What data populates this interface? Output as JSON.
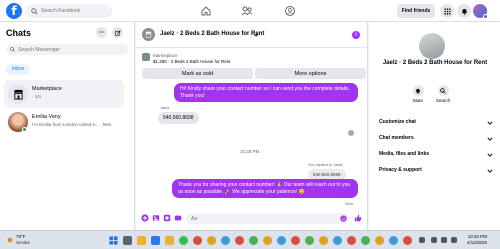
{
  "topbar": {
    "logo": "f",
    "search_placeholder": "Search Facebook",
    "find_friends": "Find friends"
  },
  "chats": {
    "title": "Chats",
    "more": "···",
    "search_placeholder": "Search Messenger",
    "inbox": "Inbox",
    "items": [
      {
        "name": "Marketplace",
        "sub": "· 1m"
      },
      {
        "name": "Emilia Veny",
        "sub": "I'm Emilia from London united k... · 58m"
      }
    ]
  },
  "conversation": {
    "title": "Jaelz · 2 Beds 2 Bath House for Rent",
    "listing_source": "Marketplace",
    "listing_price": "$1,250 · 2 Beds 2 Bath House for Rent",
    "mark_as_sold": "Mark as sold",
    "more_options": "More options",
    "msg1": "Hi! Kindly share your contact number so I can send you the complete details. Thank you!",
    "sender": "Jaelz",
    "msg2": "540.560.8698",
    "time": "10:38 PM",
    "replied": "You replied to Jaelz",
    "quoted": "540.560.8698",
    "msg3": "Thank you for sharing your contact number! 🙏 Our team will reach out to you as soon as possible. 🚀 We appreciate your patience! 😊",
    "sent": "Sent",
    "composer_placeholder": "Aa"
  },
  "details": {
    "title": "Jaelz · 2 Beds 2 Bath House for Rent",
    "mute": "Mute",
    "search": "Search",
    "rows": [
      "Customize chat",
      "Chat members",
      "Media, files and links",
      "Privacy & support"
    ]
  },
  "taskbar": {
    "temp": "79°F",
    "condition": "Smoke",
    "time": "10:40 PM",
    "date": "4/12/2025"
  },
  "colors": {
    "accent": "#a034f0",
    "facebook_blue": "#1877f2"
  }
}
